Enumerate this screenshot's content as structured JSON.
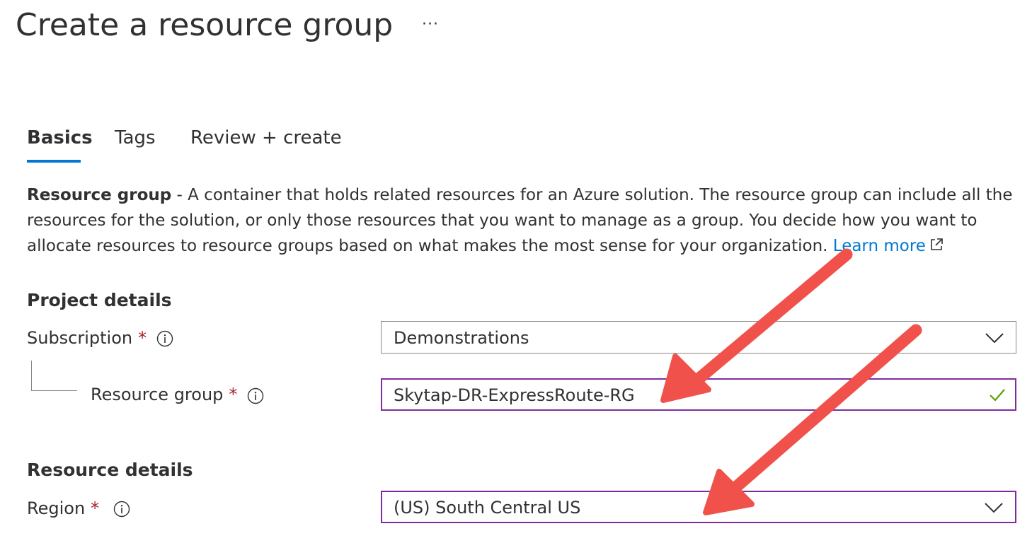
{
  "page": {
    "title": "Create a resource group",
    "more_label": "···"
  },
  "tabs": [
    {
      "label": "Basics",
      "active": true
    },
    {
      "label": "Tags",
      "active": false
    },
    {
      "label": "Review + create",
      "active": false
    }
  ],
  "description": {
    "strong": "Resource group",
    "text": " - A container that holds related resources for an Azure solution. The resource group can include all the resources for the solution, or only those resources that you want to manage as a group. You decide how you want to allocate resources to resource groups based on what makes the most sense for your organization. ",
    "link": "Learn more"
  },
  "project_details": {
    "title": "Project details",
    "subscription": {
      "label": "Subscription",
      "required_mark": "*",
      "value": "Demonstrations"
    },
    "resource_group": {
      "label": "Resource group",
      "required_mark": "*",
      "value": "Skytap-DR-ExpressRoute-RG",
      "valid": true
    }
  },
  "resource_details": {
    "title": "Resource details",
    "region": {
      "label": "Region",
      "required_mark": "*",
      "value": "(US) South Central US"
    }
  },
  "colors": {
    "accent": "#0078d4",
    "field_focus_border": "#7f2d9e",
    "required": "#a4262c",
    "valid_check": "#57a300",
    "annotation_arrow": "#f0524b"
  }
}
